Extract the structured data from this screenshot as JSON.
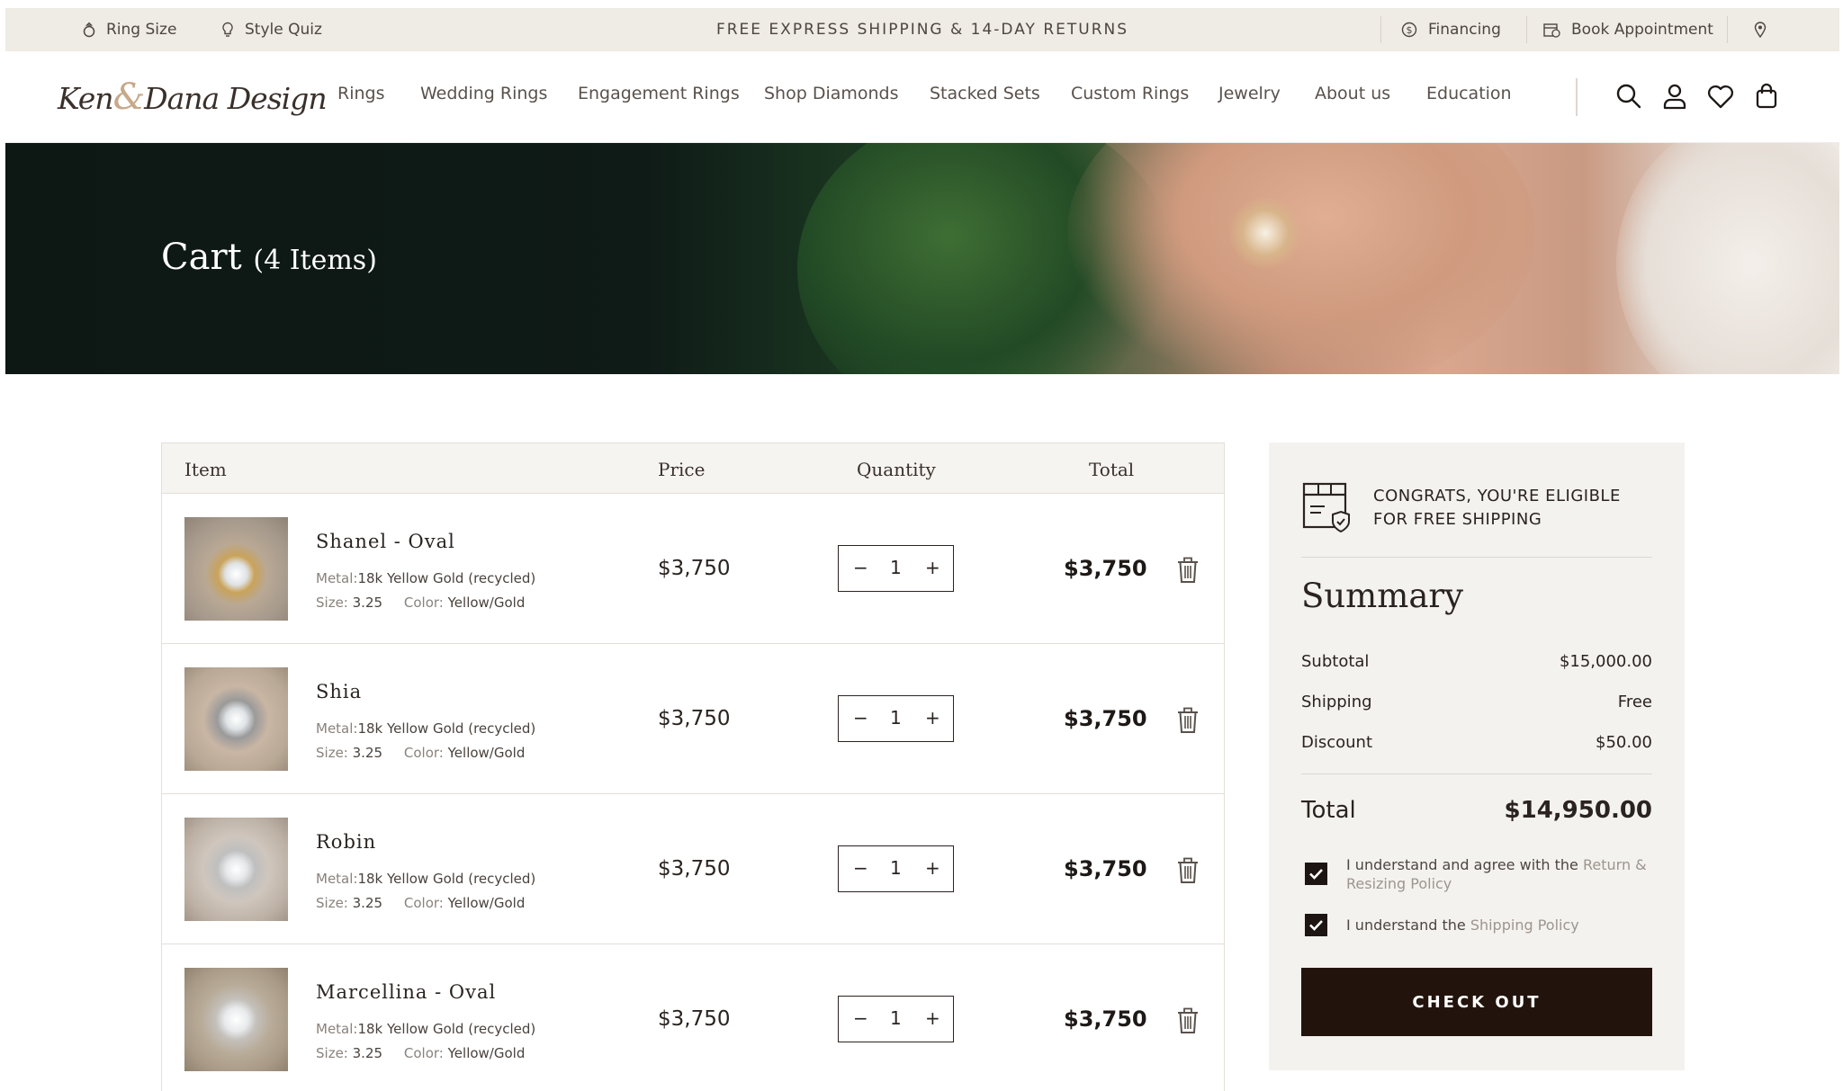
{
  "topbar": {
    "ring_size": "Ring Size",
    "style_quiz": "Style Quiz",
    "promo": "FREE EXPRESS SHIPPING & 14-DAY RETURNS",
    "financing": "Financing",
    "book_appointment": "Book Appointment"
  },
  "nav": {
    "logo": {
      "part1": "Ken",
      "amp": "&",
      "part2": "Dana Design"
    },
    "items": [
      "Rings",
      "Wedding Rings",
      "Engagement Rings",
      "Shop Diamonds",
      "Stacked Sets",
      "Custom Rings",
      "Jewelry",
      "About us",
      "Education"
    ]
  },
  "hero": {
    "title": "Cart",
    "count": "(4 Items)"
  },
  "cart": {
    "headers": {
      "item": "Item",
      "price": "Price",
      "quantity": "Quantity",
      "total": "Total"
    },
    "labels": {
      "metal": "Metal:",
      "size": "Size:",
      "color": "Color:"
    },
    "items": [
      {
        "name": "Shanel - Oval",
        "metal": "18k Yellow Gold (recycled)",
        "size": "3.25",
        "color": "Yellow/Gold",
        "price": "$3,750",
        "qty": "1",
        "total": "$3,750"
      },
      {
        "name": "Shia",
        "metal": "18k Yellow Gold (recycled)",
        "size": "3.25",
        "color": "Yellow/Gold",
        "price": "$3,750",
        "qty": "1",
        "total": "$3,750"
      },
      {
        "name": "Robin",
        "metal": "18k Yellow Gold (recycled)",
        "size": "3.25",
        "color": "Yellow/Gold",
        "price": "$3,750",
        "qty": "1",
        "total": "$3,750"
      },
      {
        "name": "Marcellina - Oval",
        "metal": "18k Yellow Gold (recycled)",
        "size": "3.25",
        "color": "Yellow/Gold",
        "price": "$3,750",
        "qty": "1",
        "total": "$3,750"
      }
    ]
  },
  "summary": {
    "shipping_banner_line1": "CONGRATS, YOU'RE ELIGIBLE",
    "shipping_banner_line2": "FOR FREE SHIPPING",
    "title": "Summary",
    "subtotal_label": "Subtotal",
    "subtotal": "$15,000.00",
    "shipping_label": "Shipping",
    "shipping": "Free",
    "discount_label": "Discount",
    "discount": "$50.00",
    "total_label": "Total",
    "total": "$14,950.00",
    "agree1_text": "I understand and agree with the ",
    "agree1_link": "Return & Resizing Policy",
    "agree2_text": "I understand the ",
    "agree2_link": "Shipping Policy",
    "checkout": "CHECK OUT"
  },
  "colors": {
    "accent_dark": "#22140c",
    "panel_bg": "#f4f2ee",
    "topbar_bg": "#efebe5"
  }
}
